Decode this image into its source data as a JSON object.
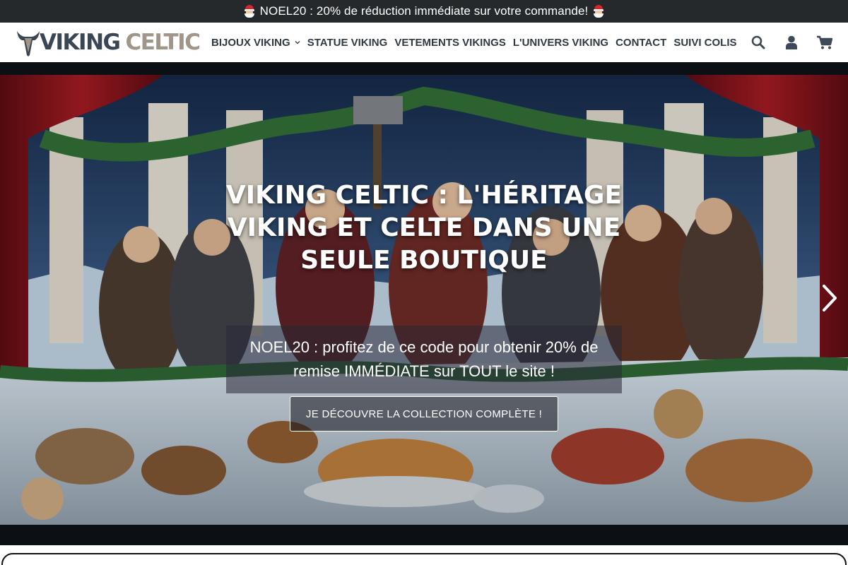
{
  "announcement": {
    "text": "NOEL20 : 20% de réduction immédiate sur votre commande!",
    "icon": "santa-icon"
  },
  "header": {
    "logo": {
      "word1": "VIKING",
      "word2": "CELTIC",
      "icon": "viking-helmet-icon"
    },
    "nav": [
      {
        "label": "BIJOUX VIKING",
        "has_dropdown": true
      },
      {
        "label": "STATUE VIKING"
      },
      {
        "label": "VETEMENTS VIKINGS"
      },
      {
        "label": "L'UNIVERS VIKING"
      },
      {
        "label": "CONTACT"
      },
      {
        "label": "SUIVI COLIS"
      }
    ],
    "icons": [
      "search-icon",
      "account-icon",
      "cart-icon"
    ]
  },
  "hero": {
    "title": "VIKING CELTIC : L'HÉRITAGE VIKING ET CELTE DANS UNE SEULE BOUTIQUE",
    "subtitle": "NOEL20 : profitez de ce code pour obtenir 20% de remise IMMÉDIATE sur TOUT le site !",
    "cta_label": "JE DÉCOUVRE LA COLLECTION COMPLÈTE !",
    "next_icon": "chevron-right-icon"
  },
  "colors": {
    "announce_bg": "#26292c",
    "nav_text": "#2f3a44",
    "logo_dark": "#3b4654",
    "logo_light": "#9f9588",
    "icon_color": "#3e4a59"
  }
}
